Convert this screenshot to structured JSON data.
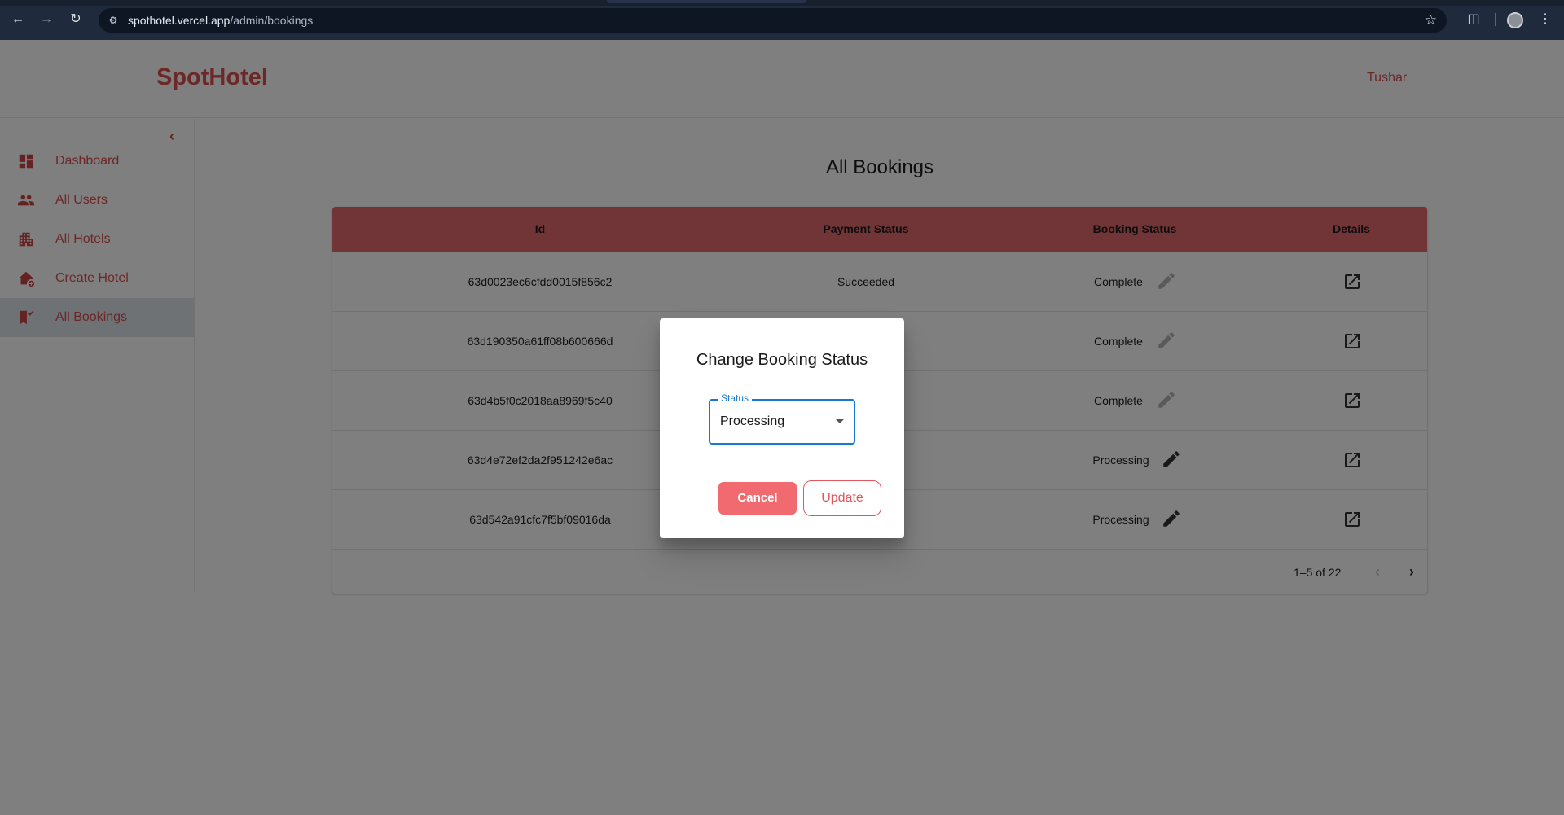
{
  "browser": {
    "url_host": "spothotel.vercel.app",
    "url_path": "/admin/bookings"
  },
  "header": {
    "brand": "SpotHotel",
    "user_name": "Tushar"
  },
  "sidebar": {
    "items": [
      {
        "label": "Dashboard",
        "icon": "dashboard-icon"
      },
      {
        "label": "All Users",
        "icon": "users-icon"
      },
      {
        "label": "All Hotels",
        "icon": "hotels-icon"
      },
      {
        "label": "Create Hotel",
        "icon": "create-hotel-icon"
      },
      {
        "label": "All Bookings",
        "icon": "bookings-icon",
        "active": true
      }
    ]
  },
  "main": {
    "title": "All Bookings",
    "table": {
      "columns": [
        "Id",
        "Payment Status",
        "Booking Status",
        "Details"
      ],
      "rows": [
        {
          "id": "63d0023ec6cfdd0015f856c2",
          "payment": "Succeeded",
          "booking": "Complete"
        },
        {
          "id": "63d190350a61ff08b600666d",
          "payment": "",
          "booking": "Complete"
        },
        {
          "id": "63d4b5f0c2018aa8969f5c40",
          "payment": "",
          "booking": "Complete"
        },
        {
          "id": "63d4e72ef2da2f951242e6ac",
          "payment": "",
          "booking": "Processing"
        },
        {
          "id": "63d542a91cfc7f5bf09016da",
          "payment": "",
          "booking": "Processing"
        }
      ],
      "pagination": "1–5 of 22"
    }
  },
  "dialog": {
    "title": "Change Booking Status",
    "select_label": "Status",
    "select_value": "Processing",
    "cancel_label": "Cancel",
    "update_label": "Update"
  },
  "colors": {
    "brand": "#d94e4e",
    "table_header": "#e36a6f",
    "focus": "#1976d2"
  }
}
